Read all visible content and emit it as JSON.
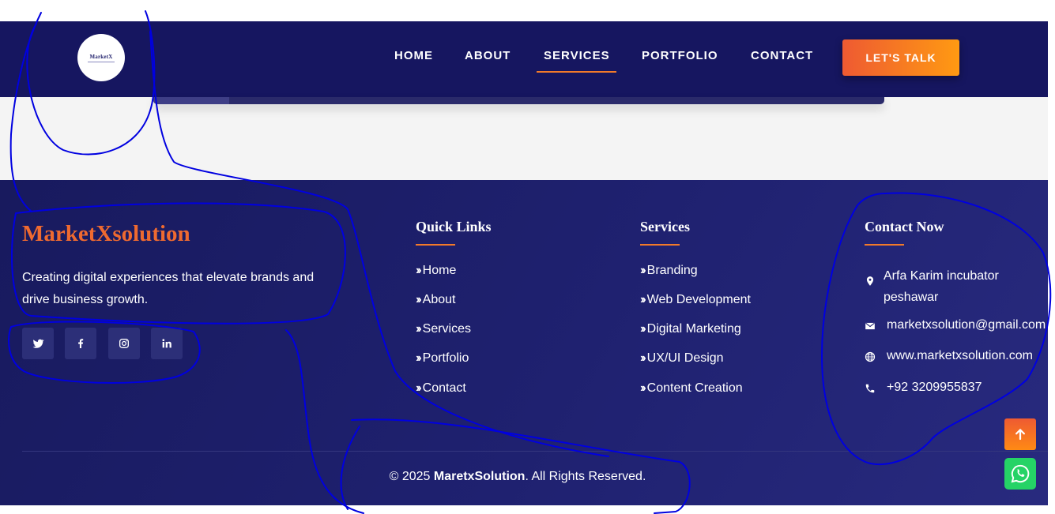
{
  "header": {
    "logo_text": "MarketX",
    "nav": [
      "HOME",
      "ABOUT",
      "SERVICES",
      "PORTFOLIO",
      "CONTACT"
    ],
    "active_nav": "SERVICES",
    "cta_label": "LET'S TALK"
  },
  "footer": {
    "brand": "MarketXsolution",
    "tagline": "Creating digital experiences that elevate brands and drive business growth.",
    "social_icons": [
      "twitter-icon",
      "facebook-icon",
      "instagram-icon",
      "linkedin-icon"
    ],
    "quick_links": {
      "title": "Quick Links",
      "items": [
        "Home",
        "About",
        "Services",
        "Portfolio",
        "Contact"
      ]
    },
    "services": {
      "title": "Services",
      "items": [
        "Branding",
        "Web Development",
        "Digital Marketing",
        "UX/UI Design",
        "Content Creation"
      ]
    },
    "contact": {
      "title": "Contact Now",
      "address_line1": "Arfa Karim incubator",
      "address_line2": "peshawar",
      "email": "marketxsolution@gmail.com",
      "website": "www.marketxsolution.com",
      "phone": "+92 3209955837"
    },
    "copyright_prefix": "© 2025 ",
    "copyright_brand": "MaretxSolution",
    "copyright_suffix": ". All Rights Reserved."
  },
  "colors": {
    "navy": "#161660",
    "accent": "#ef6a30",
    "whatsapp": "#25d366",
    "annotation_ink": "#0000e0"
  }
}
